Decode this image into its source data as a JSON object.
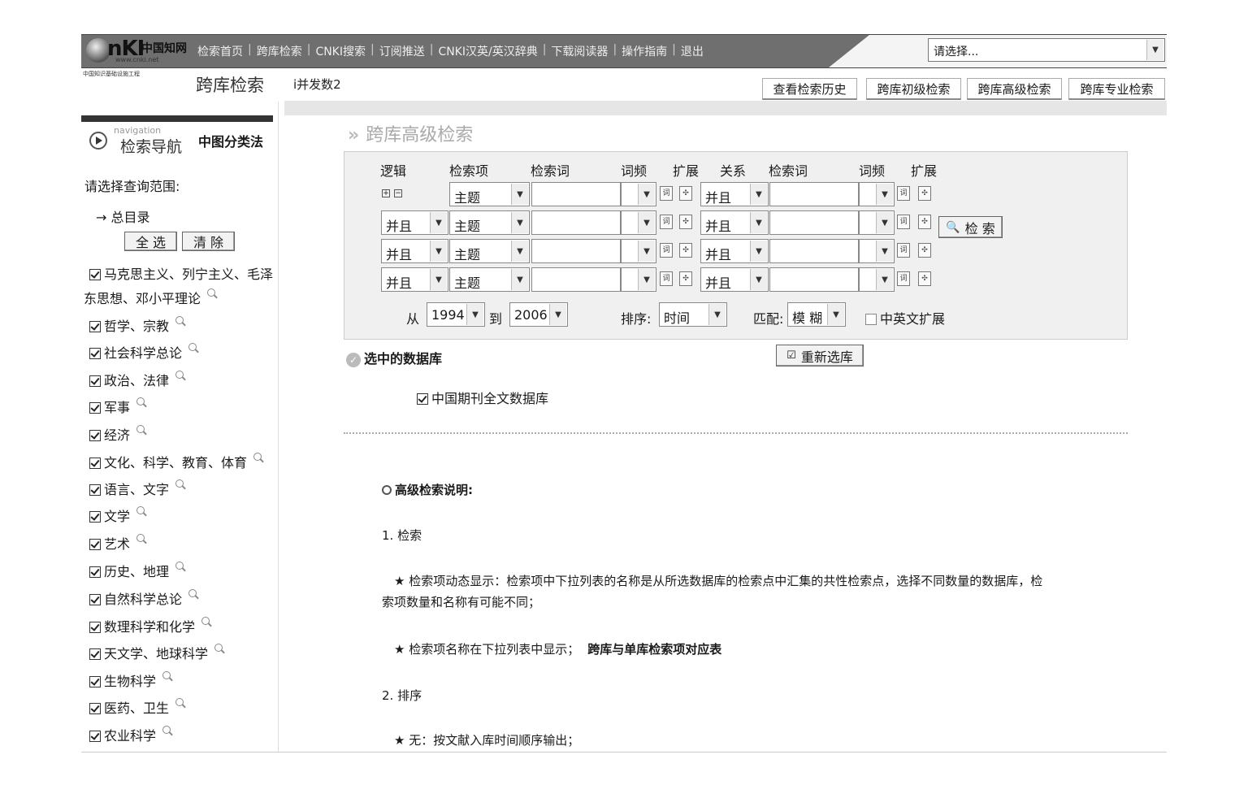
{
  "top": {
    "logo_cn": "中国知网",
    "logo_url": "www.cnki.net",
    "nav": [
      "检索首页",
      "跨库检索",
      "CNKI搜索",
      "订阅推送",
      "CNKI汉英/英汉辞典",
      "下载阅读器",
      "操作指南",
      "退出"
    ],
    "select_placeholder": "请选择..."
  },
  "header": {
    "small_org": "中国知识基础设施工程",
    "title": "跨库检索",
    "param": "i并发数2",
    "tabs": [
      "查看检索历史",
      "跨库初级检索",
      "跨库高级检索",
      "跨库专业检索"
    ]
  },
  "sidebar": {
    "nav_en": "navigation",
    "nav_zh": "检索导航",
    "classify": "中图分类法",
    "scope_label": "请选择查询范围:",
    "root": "总目录",
    "select_all": "全 选",
    "clear": "清 除",
    "items": [
      "马克思主义、列宁主义、毛泽",
      "东思想、邓小平理论",
      "哲学、宗教",
      "社会科学总论",
      "政治、法律",
      "军事",
      "经济",
      "文化、科学、教育、体育",
      "语言、文字",
      "文学",
      "艺术",
      "历史、地理",
      "自然科学总论",
      "数理科学和化学",
      "天文学、地球科学",
      "生物科学",
      "医药、卫生",
      "农业科学"
    ]
  },
  "main": {
    "title": "跨库高级检索",
    "headers": {
      "logic": "逻辑",
      "field": "检索项",
      "term": "检索词",
      "freq": "词频",
      "expand": "扩展",
      "rel": "关系",
      "term2": "检索词",
      "freq2": "词频",
      "expand2": "扩展"
    },
    "logic_value": "并且",
    "field_value": "主题",
    "rel_value": "并且",
    "search_button": "检 索",
    "from_label": "从",
    "from_year": "1994",
    "to_label": "到",
    "to_year": "2006",
    "sort_label": "排序:",
    "sort_value": "时间",
    "match_label": "匹配:",
    "match_value": "模 糊",
    "cn_en_expand": "中英文扩展",
    "selected_db_label": "选中的数据库",
    "reselect_button": "重新选库",
    "database": "中国期刊全文数据库"
  },
  "help": {
    "title": "高级检索说明:",
    "s1": "1. 检索",
    "p1a": "★ 检索项动态显示：检索项中下拉列表的名称是从所选数据库的检索点中汇集的共性检索点，选择不同数量的数据库，检",
    "p1b": "索项数量和名称有可能不同；",
    "p2a": "★ 检索项名称在下拉列表中显示；",
    "p2b": "跨库与单库检索项对应表",
    "s2": "2. 排序",
    "p3": "★ 无：按文献入库时间顺序输出；"
  }
}
